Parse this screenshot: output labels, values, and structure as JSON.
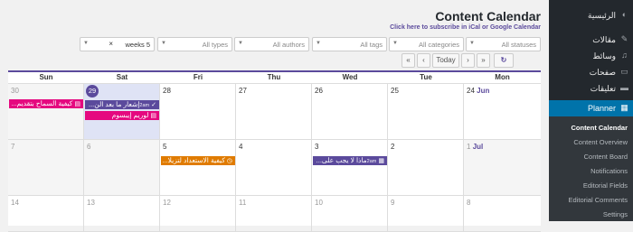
{
  "header": {
    "title": "Content Calendar",
    "subscribe_link": "Click here to subscribe in iCal or Google Calendar"
  },
  "filters": {
    "weeks": "weeks 5",
    "types": "All types",
    "authors": "All authors",
    "tags": "All tags",
    "categories": "All categories",
    "statuses": "All statuses"
  },
  "nav": {
    "first": "«",
    "prev": "‹",
    "today": "Today",
    "next": "›",
    "last": "»",
    "refresh": "↻"
  },
  "weekdays": [
    "Sun",
    "Sat",
    "Fri",
    "Thu",
    "Wed",
    "Tue",
    "Mon"
  ],
  "weeks": [
    {
      "days": [
        {
          "num": "30",
          "muted": true
        },
        {
          "num": "29",
          "today": true
        },
        {
          "num": "28"
        },
        {
          "num": "27"
        },
        {
          "num": "26"
        },
        {
          "num": "25"
        },
        {
          "num": "24",
          "month": "Jun"
        }
      ]
    },
    {
      "days": [
        {
          "num": "7",
          "muted": true
        },
        {
          "num": "6",
          "muted": true
        },
        {
          "num": "5"
        },
        {
          "num": "4"
        },
        {
          "num": "3"
        },
        {
          "num": "2"
        },
        {
          "num": "1",
          "month": "Jul"
        }
      ]
    },
    {
      "days": [
        {
          "num": "14"
        },
        {
          "num": "13"
        },
        {
          "num": "12"
        },
        {
          "num": "11"
        },
        {
          "num": "10"
        },
        {
          "num": "9"
        },
        {
          "num": "8"
        }
      ]
    }
  ],
  "events": {
    "e1": {
      "title": "كيفية السماح بتقديم...",
      "color": "#e5097f"
    },
    "e2": {
      "meta": "2am",
      "title": "إشعار ما بعد الن...",
      "color": "#5b4a9c"
    },
    "e3": {
      "title": "لوريم إيبسوم",
      "color": "#e5097f"
    },
    "e4": {
      "title": "كيفية الاستعداد لتزيلا...",
      "color": "#e07b00"
    },
    "e5": {
      "meta": "2am",
      "title": "ماذا لا يجب على...",
      "color": "#5b4a9c"
    }
  },
  "sidebar": {
    "items": [
      {
        "label": "الرئيسية",
        "icon": "dashboard-icon"
      },
      {
        "label": "مقالات",
        "icon": "pin-icon"
      },
      {
        "label": "وسائط",
        "icon": "media-icon"
      },
      {
        "label": "صفحات",
        "icon": "pages-icon"
      },
      {
        "label": "تعليقات",
        "icon": "comments-icon"
      },
      {
        "label": "Planner",
        "icon": "calendar-icon"
      }
    ],
    "submenu": [
      "Content Calendar",
      "Content Overview",
      "Content Board",
      "Notifications",
      "Editorial Fields",
      "Editorial Comments",
      "Settings"
    ]
  },
  "colors": {
    "accent": "#5b4a9c",
    "pink": "#e5097f",
    "orange": "#e07b00",
    "admin_bar": "#23282d",
    "active": "#0073aa"
  }
}
